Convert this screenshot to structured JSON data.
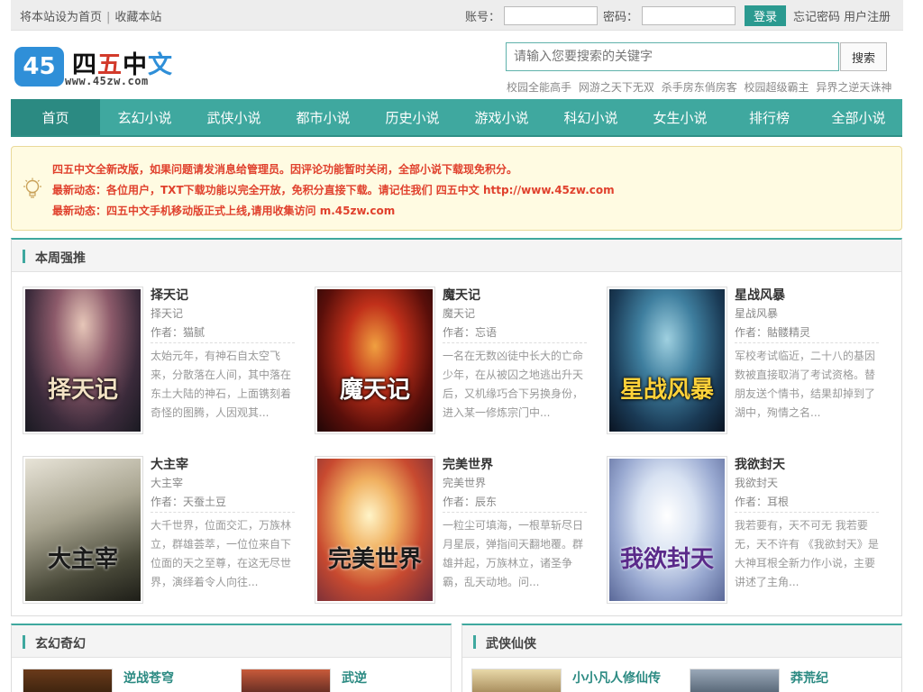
{
  "topbar": {
    "set_home": "将本站设为首页",
    "separator": "|",
    "bookmark": "收藏本站",
    "account_label": "账号：",
    "password_label": "密码：",
    "login_button": "登录",
    "forgot_password": "忘记密码",
    "register": "用户注册"
  },
  "logo": {
    "badge": "45",
    "char1": "四",
    "char2": "五",
    "char3": "中",
    "char4": "文",
    "url": "www.45zw.com"
  },
  "search": {
    "placeholder": "请输入您要搜索的关键字",
    "button": "搜索",
    "hotwords": [
      "校园全能高手",
      "网游之天下无双",
      "杀手房东俏房客",
      "校园超级霸主",
      "异界之逆天诛神"
    ]
  },
  "nav": {
    "items": [
      "首页",
      "玄幻小说",
      "武侠小说",
      "都市小说",
      "历史小说",
      "游戏小说",
      "科幻小说",
      "女生小说",
      "排行榜",
      "全部小说"
    ],
    "active_index": 0
  },
  "notice": {
    "line1": "四五中文全新改版，如果问题请发消息给管理员。因评论功能暂时关闭，全部小说下载现免积分。",
    "line2": "最新动态：各位用户，TXT下载功能以完全开放，免积分直接下载。请记住我们 四五中文 http://www.45zw.com",
    "line3": "最新动态：四五中文手机移动版正式上线,请用收集访问 m.45zw.com",
    "color": "#e0412d"
  },
  "weekly": {
    "title": "本周强推",
    "books": [
      {
        "title": "择天记",
        "sub": "择天记",
        "author": "作者：猫腻",
        "desc": "太始元年，有神石自太空飞来，分散落在人间，其中落在东土大陆的神石，上面镌刻着奇怪的图腾，人因观其...",
        "cover_text": "择天记"
      },
      {
        "title": "魔天记",
        "sub": "魔天记",
        "author": "作者：忘语",
        "desc": "一名在无数凶徒中长大的亡命少年，在从被囚之地逃出升天后，又机缘巧合下另换身份，进入某一修炼宗门中...",
        "cover_text": "魔天记"
      },
      {
        "title": "星战风暴",
        "sub": "星战风暴",
        "author": "作者：骷髅精灵",
        "desc": "军校考试临近，二十八的基因数被直接取消了考试资格。替朋友送个情书，结果却掉到了湖中，殉情之名...",
        "cover_text": "星战风暴"
      },
      {
        "title": "大主宰",
        "sub": "大主宰",
        "author": "作者：天蚕土豆",
        "desc": "大千世界，位面交汇，万族林立，群雄荟萃，一位位来自下位面的天之至尊，在这无尽世界，演绎着令人向往...",
        "cover_text": "大主宰"
      },
      {
        "title": "完美世界",
        "sub": "完美世界",
        "author": "作者：辰东",
        "desc": "一粒尘可填海，一根草斩尽日月星辰，弹指间天翻地覆。群雄并起，万族林立，诸圣争霸，乱天动地。问...",
        "cover_text": "完美世界"
      },
      {
        "title": "我欲封天",
        "sub": "我欲封天",
        "author": "作者：耳根",
        "desc": "我若要有，天不可无 我若要无，天不许有 《我欲封天》是大神耳根全新力作小说，主要讲述了主角...",
        "cover_text": "我欲封天"
      }
    ]
  },
  "sections": [
    {
      "title": "玄幻奇幻",
      "books": [
        "逆战苍穹",
        "武逆"
      ]
    },
    {
      "title": "武侠仙侠",
      "books": [
        "小小凡人修仙传",
        "莽荒纪"
      ]
    }
  ],
  "colors": {
    "teal": "#3fa89f",
    "teal_dark": "#2b8a82",
    "notice_red": "#e0412d",
    "logo_blue": "#2f8fd8"
  }
}
